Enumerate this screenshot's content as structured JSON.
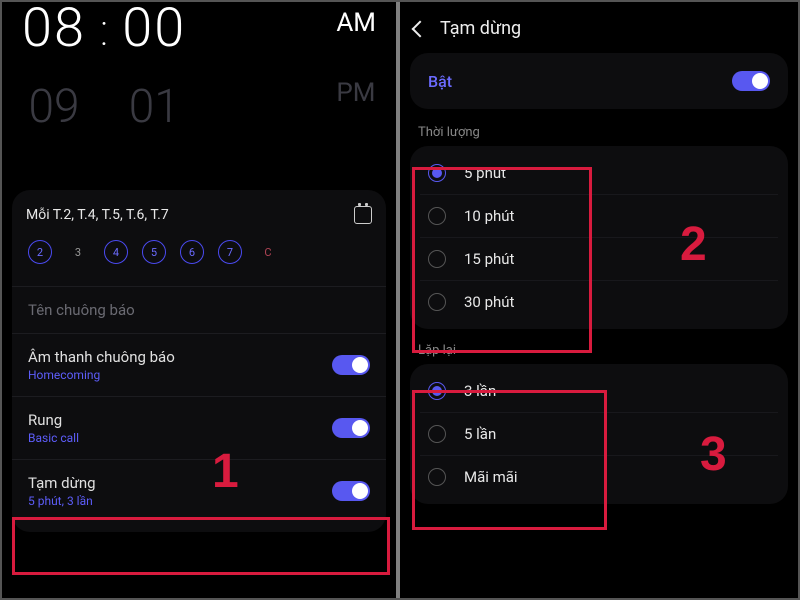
{
  "left_pane": {
    "time": {
      "hour": "08",
      "hour_next": "09",
      "minute": "00",
      "minute_next": "01",
      "am": "AM",
      "pm": "PM"
    },
    "repeat_label": "Mỗi T.2, T.4, T.5, T.6, T.7",
    "days": [
      "2",
      "3",
      "4",
      "5",
      "6",
      "7",
      "C"
    ],
    "alarm_name_hint": "Tên chuông báo",
    "sound": {
      "label": "Âm thanh chuông báo",
      "sub": "Homecoming"
    },
    "vibration": {
      "label": "Rung",
      "sub": "Basic call"
    },
    "snooze": {
      "label": "Tạm dừng",
      "sub": "5 phút, 3 lần"
    }
  },
  "right_pane": {
    "title": "Tạm dừng",
    "enable_label": "Bật",
    "duration": {
      "title": "Thời lượng",
      "options": [
        "5 phút",
        "10 phút",
        "15 phút",
        "30 phút"
      ],
      "selected": "5 phút"
    },
    "repeat": {
      "title": "Lặp lại",
      "options": [
        "3 lần",
        "5 lần",
        "Mãi mãi"
      ],
      "selected": "3 lần"
    }
  },
  "annotations": {
    "n1": "1",
    "n2": "2",
    "n3": "3"
  }
}
